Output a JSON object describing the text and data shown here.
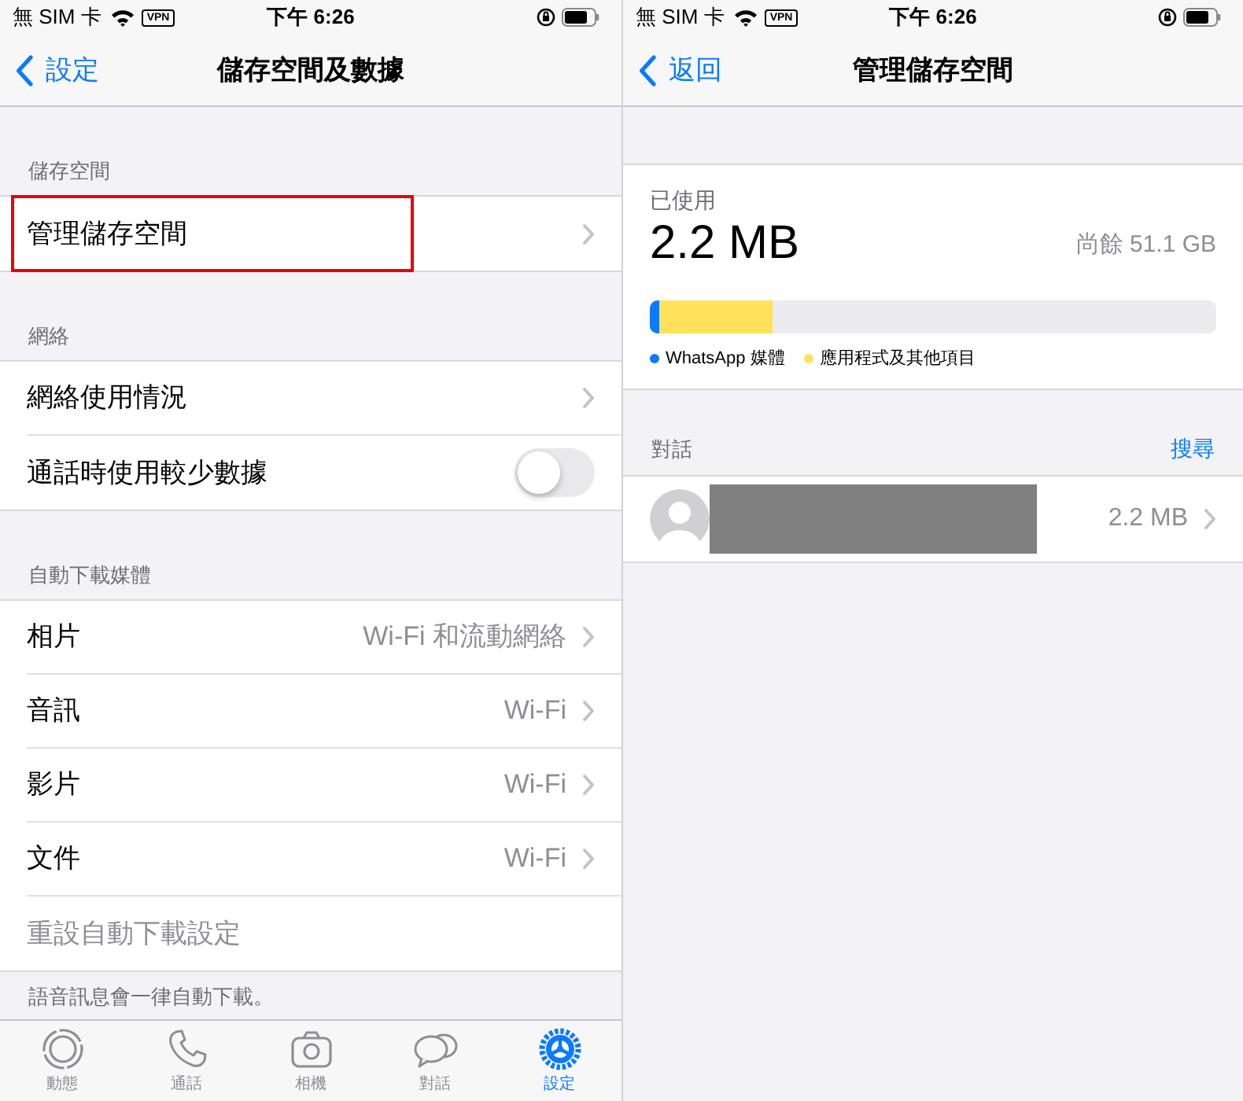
{
  "left": {
    "status_bar": {
      "carrier": "無 SIM 卡",
      "vpn": "VPN",
      "time": "下午 6:26"
    },
    "nav": {
      "back": "設定",
      "title": "儲存空間及數據"
    },
    "sections": [
      {
        "header": "儲存空間",
        "rows": [
          {
            "kind": "link",
            "label": "管理儲存空間",
            "highlighted": true
          }
        ]
      },
      {
        "header": "網絡",
        "rows": [
          {
            "kind": "link",
            "label": "網絡使用情況",
            "highlighted": false
          },
          {
            "kind": "toggle",
            "label": "通話時使用較少數據",
            "on": false,
            "highlighted": false
          }
        ]
      },
      {
        "header": "自動下載媒體",
        "rows": [
          {
            "kind": "link",
            "label": "相片",
            "value": "Wi-Fi 和流動網絡",
            "highlighted": false
          },
          {
            "kind": "link",
            "label": "音訊",
            "value": "Wi-Fi",
            "highlighted": false
          },
          {
            "kind": "link",
            "label": "影片",
            "value": "Wi-Fi",
            "highlighted": false
          },
          {
            "kind": "link",
            "label": "文件",
            "value": "Wi-Fi",
            "highlighted": false
          },
          {
            "kind": "action",
            "label": "重設自動下載設定",
            "highlighted": false
          }
        ],
        "footer": "語音訊息會一律自動下載。"
      }
    ],
    "tab_bar": [
      {
        "label": "動態",
        "selected": false
      },
      {
        "label": "通話",
        "selected": false
      },
      {
        "label": "相機",
        "selected": false
      },
      {
        "label": "對話",
        "selected": false
      },
      {
        "label": "設定",
        "selected": true
      }
    ]
  },
  "right": {
    "status_bar": {
      "carrier": "無 SIM 卡",
      "vpn": "VPN",
      "time": "下午 6:26"
    },
    "nav": {
      "back": "返回",
      "title": "管理儲存空間"
    },
    "storage": {
      "used_label": "已使用",
      "used": "2.2 MB",
      "free": "尚餘 51.1 GB",
      "usage_bar": [
        {
          "color": "#0a7aff",
          "level": 0.017
        },
        {
          "color": "#ffe15c",
          "level": 0.217
        }
      ],
      "legend": [
        {
          "label": "WhatsApp 媒體",
          "color": "#0a7aff"
        },
        {
          "label": "應用程式及其他項目",
          "color": "#ffe15c"
        }
      ]
    },
    "chats": {
      "header": "對話",
      "search": "搜尋",
      "rows": [
        {
          "size": "2.2 MB"
        }
      ]
    }
  }
}
